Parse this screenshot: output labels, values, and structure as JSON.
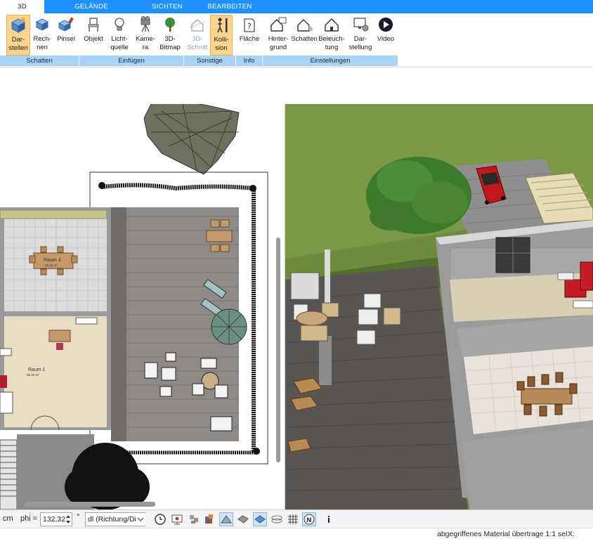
{
  "tabs": [
    {
      "label": "3D"
    },
    {
      "label": "GELÄNDE"
    },
    {
      "label": "SICHTEN"
    },
    {
      "label": "BEARBEITEN"
    }
  ],
  "ribbon": {
    "buttons": [
      {
        "label": "Dar-\nstellen",
        "icon": "cube-render-icon"
      },
      {
        "label": "Rech-\nnen",
        "icon": "cube-calc-icon"
      },
      {
        "label": "Pinsel",
        "icon": "paint-cube-icon"
      },
      {
        "label": "Objekt",
        "icon": "chair-icon"
      },
      {
        "label": "Licht-\nquelle",
        "icon": "lightbulb-icon"
      },
      {
        "label": "Kame-\nra",
        "icon": "camera-icon"
      },
      {
        "label": "3D-\nBitmap",
        "icon": "tree-icon"
      },
      {
        "label": "3D-\nSchnitt",
        "icon": "section-icon"
      },
      {
        "label": "Kolli-\nsion",
        "icon": "person-collision-icon"
      },
      {
        "label": "Fläche",
        "icon": "area-info-icon"
      },
      {
        "label": "Hinter-\ngrund",
        "icon": "house-background-icon"
      },
      {
        "label": "Schatten",
        "icon": "house-shadow-icon"
      },
      {
        "label": "Beleuch-\ntung",
        "icon": "house-light-icon"
      },
      {
        "label": "Dar-\nstellung",
        "icon": "monitor-settings-icon"
      },
      {
        "label": "Video",
        "icon": "play-icon"
      }
    ],
    "groups": [
      "Schatten",
      "Einfügen",
      "Sonstige",
      "Info",
      "Einstellungen"
    ]
  },
  "plan": {
    "room3_name": "Raum 3",
    "room3_area": "45.42 m²",
    "room1_name": "Raum 1",
    "room1_area": "66.23 m²"
  },
  "bottombar": {
    "unit": "cm",
    "phi_label": "phi =",
    "phi_value": "132,32",
    "degree": "°",
    "direction_value": "dl (Richtung/Di"
  },
  "statusbar": {
    "message": "abgegriffenes Material übertrage 1:1 sel",
    "coord_label": "X:"
  },
  "colors": {
    "tab_bar": "#1e90ff",
    "group_label": "#a9d3f7",
    "active_button": "#fcd48f",
    "grass": "#6b8a3a",
    "deck": "#5b5552"
  }
}
